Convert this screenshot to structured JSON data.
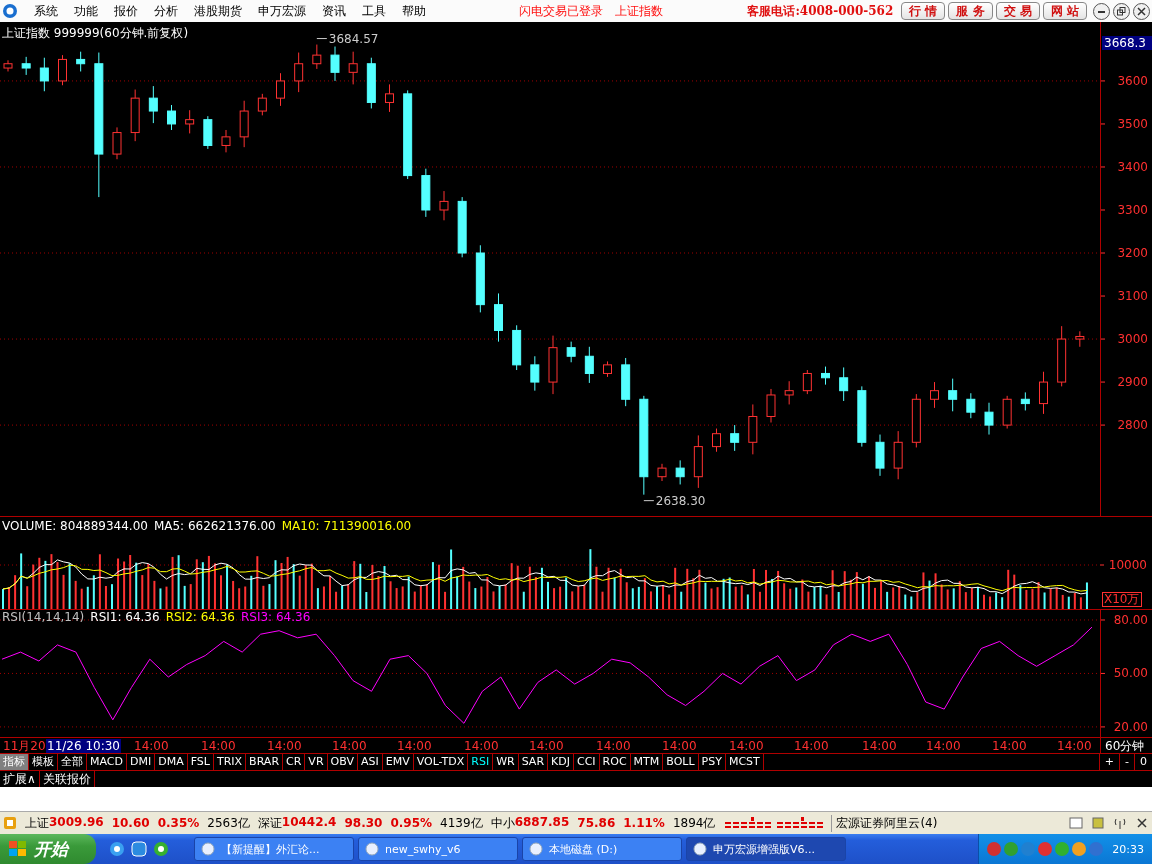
{
  "menu": {
    "items": [
      "系统",
      "功能",
      "报价",
      "分析",
      "港股期货",
      "申万宏源",
      "资讯",
      "工具",
      "帮助"
    ],
    "notices": [
      "闪电交易已登录",
      "上证指数"
    ],
    "hotline": "客服电话:4008-000-562",
    "buttons": [
      "行 情",
      "服 务",
      "交 易",
      "网 站"
    ]
  },
  "price_panel": {
    "last_price": "3668.3",
    "chart_data": {
      "type": "candlestick",
      "title": "上证指数 999999(60分钟.前复权)",
      "ylim": [
        2591,
        3737
      ],
      "yticks": [
        2800,
        2900,
        3000,
        3100,
        3200,
        3300,
        3400,
        3500,
        3600
      ],
      "grid": true,
      "ohlc": [
        [
          3630,
          3648,
          3622,
          3640
        ],
        [
          3640,
          3656,
          3614,
          3630
        ],
        [
          3630,
          3654,
          3576,
          3600
        ],
        [
          3600,
          3660,
          3590,
          3650
        ],
        [
          3650,
          3668,
          3622,
          3640
        ],
        [
          3640,
          3666,
          3330,
          3430
        ],
        [
          3430,
          3492,
          3418,
          3480
        ],
        [
          3480,
          3580,
          3460,
          3560
        ],
        [
          3560,
          3588,
          3502,
          3530
        ],
        [
          3530,
          3544,
          3486,
          3500
        ],
        [
          3500,
          3532,
          3478,
          3510
        ],
        [
          3510,
          3518,
          3442,
          3450
        ],
        [
          3450,
          3486,
          3434,
          3470
        ],
        [
          3470,
          3554,
          3446,
          3530
        ],
        [
          3530,
          3570,
          3520,
          3560
        ],
        [
          3560,
          3618,
          3542,
          3600
        ],
        [
          3600,
          3666,
          3574,
          3640
        ],
        [
          3640,
          3684.57,
          3628,
          3660
        ],
        [
          3660,
          3680,
          3600,
          3620
        ],
        [
          3620,
          3668,
          3592,
          3640
        ],
        [
          3640,
          3654,
          3536,
          3550
        ],
        [
          3550,
          3592,
          3528,
          3570
        ],
        [
          3570,
          3578,
          3372,
          3380
        ],
        [
          3380,
          3396,
          3284,
          3300
        ],
        [
          3300,
          3344,
          3276,
          3320
        ],
        [
          3320,
          3330,
          3190,
          3200
        ],
        [
          3200,
          3218,
          3062,
          3080
        ],
        [
          3080,
          3106,
          2994,
          3020
        ],
        [
          3020,
          3032,
          2928,
          2940
        ],
        [
          2940,
          2960,
          2880,
          2900
        ],
        [
          2900,
          3008,
          2872,
          2980
        ],
        [
          2980,
          2994,
          2946,
          2960
        ],
        [
          2960,
          2982,
          2898,
          2920
        ],
        [
          2920,
          2948,
          2912,
          2940
        ],
        [
          2940,
          2956,
          2844,
          2860
        ],
        [
          2860,
          2868,
          2638.3,
          2680
        ],
        [
          2680,
          2710,
          2670,
          2700
        ],
        [
          2700,
          2718,
          2662,
          2680
        ],
        [
          2680,
          2776,
          2654,
          2750
        ],
        [
          2750,
          2792,
          2738,
          2780
        ],
        [
          2780,
          2800,
          2740,
          2760
        ],
        [
          2760,
          2848,
          2732,
          2820
        ],
        [
          2820,
          2884,
          2806,
          2870
        ],
        [
          2870,
          2902,
          2848,
          2880
        ],
        [
          2880,
          2928,
          2872,
          2920
        ],
        [
          2920,
          2936,
          2894,
          2910
        ],
        [
          2910,
          2934,
          2856,
          2880
        ],
        [
          2880,
          2890,
          2750,
          2760
        ],
        [
          2760,
          2778,
          2682,
          2700
        ],
        [
          2700,
          2786,
          2674,
          2760
        ],
        [
          2760,
          2872,
          2748,
          2860
        ],
        [
          2860,
          2900,
          2840,
          2880
        ],
        [
          2880,
          2908,
          2832,
          2860
        ],
        [
          2860,
          2874,
          2816,
          2830
        ],
        [
          2830,
          2852,
          2778,
          2800
        ],
        [
          2800,
          2868,
          2792,
          2860
        ],
        [
          2860,
          2876,
          2834,
          2850
        ],
        [
          2850,
          2924,
          2826,
          2900
        ],
        [
          2900,
          3030,
          2890,
          3000
        ],
        [
          3000,
          3018,
          2982,
          3006
        ]
      ],
      "annotations": [
        "3684.57",
        "2638.30"
      ]
    }
  },
  "volume_panel": {
    "legend": [
      {
        "text": "VOLUME: 804889344.00",
        "color": "#ffffff"
      },
      {
        "text": "MA5: 662621376.00",
        "color": "#ffffff"
      },
      {
        "text": "MA10: 711390016.00",
        "color": "#ffff00"
      }
    ],
    "axis_label": "10000",
    "unit": "X10万"
  },
  "rsi_panel": {
    "legend": [
      {
        "text": "RSI(14,14,14)",
        "color": "#c0c0c0"
      },
      {
        "text": "RSI1: 64.36",
        "color": "#ffffff"
      },
      {
        "text": "RSI2: 64.36",
        "color": "#ffff00"
      },
      {
        "text": "RSI3: 64.36",
        "color": "#ff00ff"
      }
    ],
    "chart_data": {
      "type": "line",
      "ylim": [
        14.9,
        85.6
      ],
      "grid": true,
      "yticks": [
        {
          "value": 20,
          "label": "20.00"
        },
        {
          "value": 50,
          "label": "50.00"
        },
        {
          "value": 80,
          "label": "80.00"
        }
      ],
      "series": [
        {
          "color": "#ff00ff",
          "values": [
            58,
            62,
            57,
            66,
            62,
            42,
            24,
            42,
            58,
            48,
            55,
            60,
            68,
            62,
            72,
            74,
            70,
            72,
            60,
            46,
            40,
            58,
            60,
            50,
            32,
            22,
            40,
            48,
            30,
            45,
            52,
            44,
            50,
            58,
            56,
            48,
            38,
            32,
            40,
            50,
            44,
            54,
            60,
            46,
            52,
            66,
            72,
            68,
            72,
            55,
            34,
            30,
            48,
            64,
            68,
            60,
            54,
            60,
            66,
            76
          ]
        }
      ]
    }
  },
  "x_axis": {
    "labels": [
      {
        "text": "11月20",
        "selected": false
      },
      {
        "text": "11/26 10:30",
        "selected": true
      },
      {
        "text": "14:00",
        "selected": false
      },
      {
        "text": "14:00",
        "selected": false
      },
      {
        "text": "14:00",
        "selected": false
      },
      {
        "text": "14:00",
        "selected": false
      },
      {
        "text": "14:00",
        "selected": false
      },
      {
        "text": "14:00",
        "selected": false
      },
      {
        "text": "14:00",
        "selected": false
      },
      {
        "text": "14:00",
        "selected": false
      },
      {
        "text": "14:00",
        "selected": false
      },
      {
        "text": "14:00",
        "selected": false
      },
      {
        "text": "14:00",
        "selected": false
      },
      {
        "text": "14:00",
        "selected": false
      },
      {
        "text": "14:00",
        "selected": false
      },
      {
        "text": "14:00",
        "selected": false
      },
      {
        "text": "14:00",
        "selected": false
      }
    ],
    "period": "60分钟"
  },
  "mode_tabs": [
    {
      "label": "指标",
      "selected": true
    },
    {
      "label": "模板",
      "selected": false
    }
  ],
  "indicator_tabs": [
    {
      "label": "全部",
      "selected": false
    },
    {
      "label": "MACD",
      "selected": false
    },
    {
      "label": "DMI",
      "selected": false
    },
    {
      "label": "DMA",
      "selected": false
    },
    {
      "label": "FSL",
      "selected": false
    },
    {
      "label": "TRIX",
      "selected": false
    },
    {
      "label": "BRAR",
      "selected": false
    },
    {
      "label": "CR",
      "selected": false
    },
    {
      "label": "VR",
      "selected": false
    },
    {
      "label": "OBV",
      "selected": false
    },
    {
      "label": "ASI",
      "selected": false
    },
    {
      "label": "EMV",
      "selected": false
    },
    {
      "label": "VOL-TDX",
      "selected": false
    },
    {
      "label": "RSI",
      "selected": true
    },
    {
      "label": "WR",
      "selected": false
    },
    {
      "label": "SAR",
      "selected": false
    },
    {
      "label": "KDJ",
      "selected": false
    },
    {
      "label": "CCI",
      "selected": false
    },
    {
      "label": "ROC",
      "selected": false
    },
    {
      "label": "MTM",
      "selected": false
    },
    {
      "label": "BOLL",
      "selected": false
    },
    {
      "label": "PSY",
      "selected": false
    },
    {
      "label": "MCST",
      "selected": false
    }
  ],
  "zoom_buttons": [
    "+",
    "-",
    "0"
  ],
  "bottom_tabs": [
    "扩展∧",
    "关联报价"
  ],
  "status_bar": {
    "indices": [
      {
        "name": "上证",
        "value": "3009.96",
        "change": "10.60",
        "percent": "0.35%",
        "amount": "2563亿"
      },
      {
        "name": "深证",
        "value": "10442.4",
        "change": "98.30",
        "percent": "0.95%",
        "amount": "4139亿"
      },
      {
        "name": "中小",
        "value": "6887.85",
        "change": "75.86",
        "percent": "1.11%",
        "amount": "1894亿"
      }
    ],
    "server": "宏源证券阿里云(4)"
  },
  "taskbar": {
    "start": "开始",
    "tasks": [
      {
        "label": "【新提醒】外汇论...",
        "selected": false
      },
      {
        "label": "new_swhy_v6",
        "selected": false
      },
      {
        "label": "本地磁盘 (D:)",
        "selected": false
      },
      {
        "label": "申万宏源增强版V6...",
        "selected": true
      }
    ],
    "clock": "20:33"
  }
}
